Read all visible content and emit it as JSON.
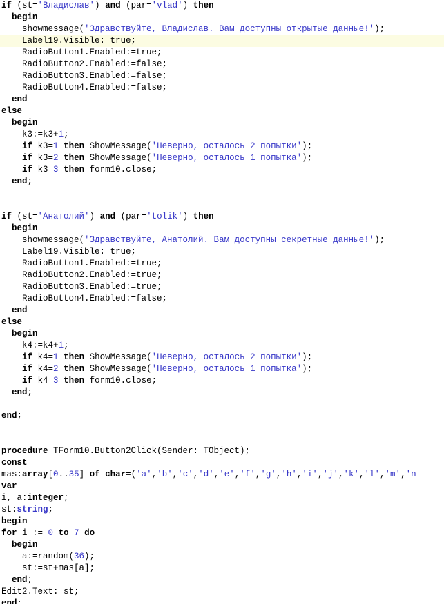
{
  "editor": {
    "name": "pascal-code-editor",
    "language": "Pascal/Delphi",
    "colors": {
      "background": "#ffffff",
      "text": "#000000",
      "keyword": "#000000",
      "string": "#3838c8",
      "number": "#3838c8",
      "type": "#3838c8",
      "highlight_line": "#fcfce2"
    },
    "lines": [
      {
        "i": 0,
        "highlight": false,
        "tokens": [
          {
            "t": "kw",
            "v": "if"
          },
          {
            "t": "pun",
            "v": " (st="
          },
          {
            "t": "str",
            "v": "'Владислав'"
          },
          {
            "t": "pun",
            "v": ") "
          },
          {
            "t": "kw",
            "v": "and"
          },
          {
            "t": "pun",
            "v": " (par="
          },
          {
            "t": "str",
            "v": "'vlad'"
          },
          {
            "t": "pun",
            "v": ") "
          },
          {
            "t": "kw",
            "v": "then"
          }
        ]
      },
      {
        "i": 1,
        "highlight": false,
        "tokens": [
          {
            "t": "pun",
            "v": "  "
          },
          {
            "t": "kw",
            "v": "begin"
          }
        ]
      },
      {
        "i": 2,
        "highlight": false,
        "tokens": [
          {
            "t": "pun",
            "v": "    showmessage("
          },
          {
            "t": "str",
            "v": "'Здравствуйте, Владислав. Вам доступны открытые данные!'"
          },
          {
            "t": "pun",
            "v": ");"
          }
        ]
      },
      {
        "i": 3,
        "highlight": true,
        "tokens": [
          {
            "t": "pun",
            "v": "    Label19.Visible:=true;"
          }
        ]
      },
      {
        "i": 4,
        "highlight": false,
        "tokens": [
          {
            "t": "pun",
            "v": "    RadioButton1.Enabled:=true;"
          }
        ]
      },
      {
        "i": 5,
        "highlight": false,
        "tokens": [
          {
            "t": "pun",
            "v": "    RadioButton2.Enabled:=false;"
          }
        ]
      },
      {
        "i": 6,
        "highlight": false,
        "tokens": [
          {
            "t": "pun",
            "v": "    RadioButton3.Enabled:=false;"
          }
        ]
      },
      {
        "i": 7,
        "highlight": false,
        "tokens": [
          {
            "t": "pun",
            "v": "    RadioButton4.Enabled:=false;"
          }
        ]
      },
      {
        "i": 8,
        "highlight": false,
        "tokens": [
          {
            "t": "pun",
            "v": "  "
          },
          {
            "t": "kw",
            "v": "end"
          }
        ]
      },
      {
        "i": 9,
        "highlight": false,
        "tokens": [
          {
            "t": "kw",
            "v": "else"
          }
        ]
      },
      {
        "i": 10,
        "highlight": false,
        "tokens": [
          {
            "t": "pun",
            "v": "  "
          },
          {
            "t": "kw",
            "v": "begin"
          }
        ]
      },
      {
        "i": 11,
        "highlight": false,
        "tokens": [
          {
            "t": "pun",
            "v": "    k3:=k3+"
          },
          {
            "t": "num",
            "v": "1"
          },
          {
            "t": "pun",
            "v": ";"
          }
        ]
      },
      {
        "i": 12,
        "highlight": false,
        "tokens": [
          {
            "t": "pun",
            "v": "    "
          },
          {
            "t": "kw",
            "v": "if"
          },
          {
            "t": "pun",
            "v": " k3="
          },
          {
            "t": "num",
            "v": "1"
          },
          {
            "t": "pun",
            "v": " "
          },
          {
            "t": "kw",
            "v": "then"
          },
          {
            "t": "pun",
            "v": " ShowMessage("
          },
          {
            "t": "str",
            "v": "'Неверно, осталось 2 попытки'"
          },
          {
            "t": "pun",
            "v": ");"
          }
        ]
      },
      {
        "i": 13,
        "highlight": false,
        "tokens": [
          {
            "t": "pun",
            "v": "    "
          },
          {
            "t": "kw",
            "v": "if"
          },
          {
            "t": "pun",
            "v": " k3="
          },
          {
            "t": "num",
            "v": "2"
          },
          {
            "t": "pun",
            "v": " "
          },
          {
            "t": "kw",
            "v": "then"
          },
          {
            "t": "pun",
            "v": " ShowMessage("
          },
          {
            "t": "str",
            "v": "'Неверно, осталось 1 попытка'"
          },
          {
            "t": "pun",
            "v": ");"
          }
        ]
      },
      {
        "i": 14,
        "highlight": false,
        "tokens": [
          {
            "t": "pun",
            "v": "    "
          },
          {
            "t": "kw",
            "v": "if"
          },
          {
            "t": "pun",
            "v": " k3="
          },
          {
            "t": "num",
            "v": "3"
          },
          {
            "t": "pun",
            "v": " "
          },
          {
            "t": "kw",
            "v": "then"
          },
          {
            "t": "pun",
            "v": " form10.close;"
          }
        ]
      },
      {
        "i": 15,
        "highlight": false,
        "tokens": [
          {
            "t": "pun",
            "v": "  "
          },
          {
            "t": "kw",
            "v": "end"
          },
          {
            "t": "pun",
            "v": ";"
          }
        ]
      },
      {
        "i": 16,
        "highlight": false,
        "tokens": []
      },
      {
        "i": 17,
        "highlight": false,
        "tokens": []
      },
      {
        "i": 18,
        "highlight": false,
        "tokens": [
          {
            "t": "kw",
            "v": "if"
          },
          {
            "t": "pun",
            "v": " (st="
          },
          {
            "t": "str",
            "v": "'Анатолий'"
          },
          {
            "t": "pun",
            "v": ") "
          },
          {
            "t": "kw",
            "v": "and"
          },
          {
            "t": "pun",
            "v": " (par="
          },
          {
            "t": "str",
            "v": "'tolik'"
          },
          {
            "t": "pun",
            "v": ") "
          },
          {
            "t": "kw",
            "v": "then"
          }
        ]
      },
      {
        "i": 19,
        "highlight": false,
        "tokens": [
          {
            "t": "pun",
            "v": "  "
          },
          {
            "t": "kw",
            "v": "begin"
          }
        ]
      },
      {
        "i": 20,
        "highlight": false,
        "tokens": [
          {
            "t": "pun",
            "v": "    showmessage("
          },
          {
            "t": "str",
            "v": "'Здравствуйте, Анатолий. Вам доступны секретные данные!'"
          },
          {
            "t": "pun",
            "v": ");"
          }
        ]
      },
      {
        "i": 21,
        "highlight": false,
        "tokens": [
          {
            "t": "pun",
            "v": "    Label19.Visible:=true;"
          }
        ]
      },
      {
        "i": 22,
        "highlight": false,
        "tokens": [
          {
            "t": "pun",
            "v": "    RadioButton1.Enabled:=true;"
          }
        ]
      },
      {
        "i": 23,
        "highlight": false,
        "tokens": [
          {
            "t": "pun",
            "v": "    RadioButton2.Enabled:=true;"
          }
        ]
      },
      {
        "i": 24,
        "highlight": false,
        "tokens": [
          {
            "t": "pun",
            "v": "    RadioButton3.Enabled:=true;"
          }
        ]
      },
      {
        "i": 25,
        "highlight": false,
        "tokens": [
          {
            "t": "pun",
            "v": "    RadioButton4.Enabled:=false;"
          }
        ]
      },
      {
        "i": 26,
        "highlight": false,
        "tokens": [
          {
            "t": "pun",
            "v": "  "
          },
          {
            "t": "kw",
            "v": "end"
          }
        ]
      },
      {
        "i": 27,
        "highlight": false,
        "tokens": [
          {
            "t": "kw",
            "v": "else"
          }
        ]
      },
      {
        "i": 28,
        "highlight": false,
        "tokens": [
          {
            "t": "pun",
            "v": "  "
          },
          {
            "t": "kw",
            "v": "begin"
          }
        ]
      },
      {
        "i": 29,
        "highlight": false,
        "tokens": [
          {
            "t": "pun",
            "v": "    k4:=k4+"
          },
          {
            "t": "num",
            "v": "1"
          },
          {
            "t": "pun",
            "v": ";"
          }
        ]
      },
      {
        "i": 30,
        "highlight": false,
        "tokens": [
          {
            "t": "pun",
            "v": "    "
          },
          {
            "t": "kw",
            "v": "if"
          },
          {
            "t": "pun",
            "v": " k4="
          },
          {
            "t": "num",
            "v": "1"
          },
          {
            "t": "pun",
            "v": " "
          },
          {
            "t": "kw",
            "v": "then"
          },
          {
            "t": "pun",
            "v": " ShowMessage("
          },
          {
            "t": "str",
            "v": "'Неверно, осталось 2 попытки'"
          },
          {
            "t": "pun",
            "v": ");"
          }
        ]
      },
      {
        "i": 31,
        "highlight": false,
        "tokens": [
          {
            "t": "pun",
            "v": "    "
          },
          {
            "t": "kw",
            "v": "if"
          },
          {
            "t": "pun",
            "v": " k4="
          },
          {
            "t": "num",
            "v": "2"
          },
          {
            "t": "pun",
            "v": " "
          },
          {
            "t": "kw",
            "v": "then"
          },
          {
            "t": "pun",
            "v": " ShowMessage("
          },
          {
            "t": "str",
            "v": "'Неверно, осталось 1 попытка'"
          },
          {
            "t": "pun",
            "v": ");"
          }
        ]
      },
      {
        "i": 32,
        "highlight": false,
        "tokens": [
          {
            "t": "pun",
            "v": "    "
          },
          {
            "t": "kw",
            "v": "if"
          },
          {
            "t": "pun",
            "v": " k4="
          },
          {
            "t": "num",
            "v": "3"
          },
          {
            "t": "pun",
            "v": " "
          },
          {
            "t": "kw",
            "v": "then"
          },
          {
            "t": "pun",
            "v": " form10.close;"
          }
        ]
      },
      {
        "i": 33,
        "highlight": false,
        "tokens": [
          {
            "t": "pun",
            "v": "  "
          },
          {
            "t": "kw",
            "v": "end"
          },
          {
            "t": "pun",
            "v": ";"
          }
        ]
      },
      {
        "i": 34,
        "highlight": false,
        "tokens": []
      },
      {
        "i": 35,
        "highlight": false,
        "tokens": [
          {
            "t": "kw",
            "v": "end"
          },
          {
            "t": "pun",
            "v": ";"
          }
        ]
      },
      {
        "i": 36,
        "highlight": false,
        "tokens": []
      },
      {
        "i": 37,
        "highlight": false,
        "tokens": []
      },
      {
        "i": 38,
        "highlight": false,
        "tokens": [
          {
            "t": "kw",
            "v": "procedure"
          },
          {
            "t": "pun",
            "v": " TForm10.Button2Click(Sender: TObject);"
          }
        ]
      },
      {
        "i": 39,
        "highlight": false,
        "tokens": [
          {
            "t": "kw",
            "v": "const"
          }
        ]
      },
      {
        "i": 40,
        "highlight": false,
        "tokens": [
          {
            "t": "pun",
            "v": "mas:"
          },
          {
            "t": "kw",
            "v": "array"
          },
          {
            "t": "pun",
            "v": "["
          },
          {
            "t": "num",
            "v": "0"
          },
          {
            "t": "pun",
            "v": ".."
          },
          {
            "t": "num",
            "v": "35"
          },
          {
            "t": "pun",
            "v": "] "
          },
          {
            "t": "kw",
            "v": "of"
          },
          {
            "t": "pun",
            "v": " "
          },
          {
            "t": "kw",
            "v": "char"
          },
          {
            "t": "pun",
            "v": "=("
          },
          {
            "t": "str",
            "v": "'a'"
          },
          {
            "t": "pun",
            "v": ","
          },
          {
            "t": "str",
            "v": "'b'"
          },
          {
            "t": "pun",
            "v": ","
          },
          {
            "t": "str",
            "v": "'c'"
          },
          {
            "t": "pun",
            "v": ","
          },
          {
            "t": "str",
            "v": "'d'"
          },
          {
            "t": "pun",
            "v": ","
          },
          {
            "t": "str",
            "v": "'e'"
          },
          {
            "t": "pun",
            "v": ","
          },
          {
            "t": "str",
            "v": "'f'"
          },
          {
            "t": "pun",
            "v": ","
          },
          {
            "t": "str",
            "v": "'g'"
          },
          {
            "t": "pun",
            "v": ","
          },
          {
            "t": "str",
            "v": "'h'"
          },
          {
            "t": "pun",
            "v": ","
          },
          {
            "t": "str",
            "v": "'i'"
          },
          {
            "t": "pun",
            "v": ","
          },
          {
            "t": "str",
            "v": "'j'"
          },
          {
            "t": "pun",
            "v": ","
          },
          {
            "t": "str",
            "v": "'k'"
          },
          {
            "t": "pun",
            "v": ","
          },
          {
            "t": "str",
            "v": "'l'"
          },
          {
            "t": "pun",
            "v": ","
          },
          {
            "t": "str",
            "v": "'m'"
          },
          {
            "t": "pun",
            "v": ","
          },
          {
            "t": "str",
            "v": "'n"
          }
        ]
      },
      {
        "i": 41,
        "highlight": false,
        "tokens": [
          {
            "t": "kw",
            "v": "var"
          }
        ]
      },
      {
        "i": 42,
        "highlight": false,
        "tokens": [
          {
            "t": "pun",
            "v": "i, a:"
          },
          {
            "t": "kw",
            "v": "integer"
          },
          {
            "t": "pun",
            "v": ";"
          }
        ]
      },
      {
        "i": 43,
        "highlight": false,
        "tokens": [
          {
            "t": "pun",
            "v": "st:"
          },
          {
            "t": "typ",
            "v": "string"
          },
          {
            "t": "pun",
            "v": ";"
          }
        ]
      },
      {
        "i": 44,
        "highlight": false,
        "tokens": [
          {
            "t": "kw",
            "v": "begin"
          }
        ]
      },
      {
        "i": 45,
        "highlight": false,
        "tokens": [
          {
            "t": "kw",
            "v": "for"
          },
          {
            "t": "pun",
            "v": " i := "
          },
          {
            "t": "num",
            "v": "0"
          },
          {
            "t": "pun",
            "v": " "
          },
          {
            "t": "kw",
            "v": "to"
          },
          {
            "t": "pun",
            "v": " "
          },
          {
            "t": "num",
            "v": "7"
          },
          {
            "t": "pun",
            "v": " "
          },
          {
            "t": "kw",
            "v": "do"
          }
        ]
      },
      {
        "i": 46,
        "highlight": false,
        "tokens": [
          {
            "t": "pun",
            "v": "  "
          },
          {
            "t": "kw",
            "v": "begin"
          }
        ]
      },
      {
        "i": 47,
        "highlight": false,
        "tokens": [
          {
            "t": "pun",
            "v": "    a:=random("
          },
          {
            "t": "num",
            "v": "36"
          },
          {
            "t": "pun",
            "v": ");"
          }
        ]
      },
      {
        "i": 48,
        "highlight": false,
        "tokens": [
          {
            "t": "pun",
            "v": "    st:=st+mas[a];"
          }
        ]
      },
      {
        "i": 49,
        "highlight": false,
        "tokens": [
          {
            "t": "pun",
            "v": "  "
          },
          {
            "t": "kw",
            "v": "end"
          },
          {
            "t": "pun",
            "v": ";"
          }
        ]
      },
      {
        "i": 50,
        "highlight": false,
        "tokens": [
          {
            "t": "pun",
            "v": "Edit2.Text:=st;"
          }
        ]
      },
      {
        "i": 51,
        "highlight": false,
        "tokens": [
          {
            "t": "kw",
            "v": "end"
          },
          {
            "t": "pun",
            "v": ";"
          }
        ]
      }
    ]
  }
}
